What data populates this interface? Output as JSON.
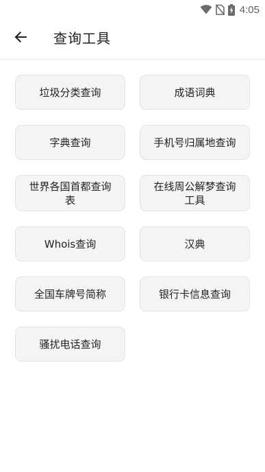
{
  "status_bar": {
    "time": "4:05",
    "icons": [
      "wifi-icon",
      "no-sim-icon",
      "battery-charging-icon"
    ]
  },
  "app_bar": {
    "back_icon": "arrow-left-icon",
    "title": "查询工具"
  },
  "tools": [
    {
      "label": "垃圾分类查询"
    },
    {
      "label": "成语词典"
    },
    {
      "label": "字典查询"
    },
    {
      "label": "手机号归属地查询"
    },
    {
      "label": "世界各国首都查询表"
    },
    {
      "label": "在线周公解梦查询工具"
    },
    {
      "label": "Whois查询"
    },
    {
      "label": "汉典"
    },
    {
      "label": "全国车牌号简称"
    },
    {
      "label": "银行卡信息查询"
    },
    {
      "label": "骚扰电话查询"
    }
  ],
  "colors": {
    "background": "#ffffff",
    "button_background": "#f4f4f4",
    "button_border": "#e3e3e3",
    "text": "#222222",
    "status_icons": "#6b6b6b"
  }
}
